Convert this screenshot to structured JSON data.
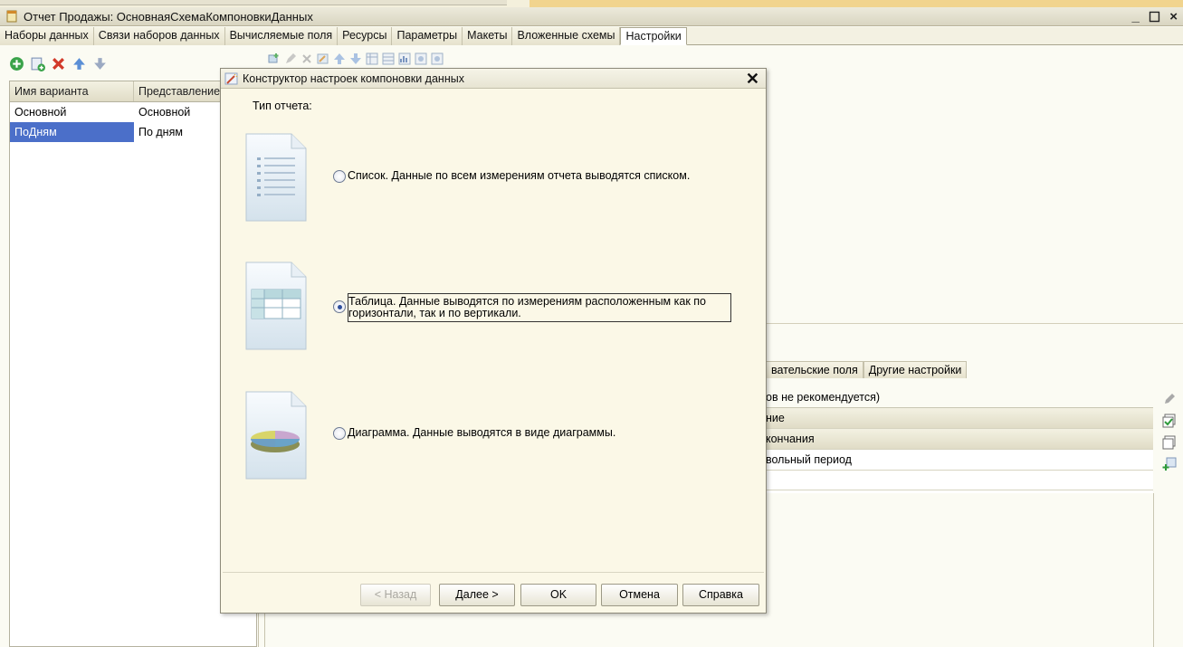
{
  "window": {
    "title": "Отчет Продажы: ОсновнаяСхемаКомпоновкиДанных",
    "controls": [
      "_",
      "☐",
      "×"
    ]
  },
  "tabs": [
    {
      "label": "Наборы данных"
    },
    {
      "label": "Связи наборов данных"
    },
    {
      "label": "Вычисляемые поля"
    },
    {
      "label": "Ресурсы"
    },
    {
      "label": "Параметры"
    },
    {
      "label": "Макеты"
    },
    {
      "label": "Вложенные схемы"
    },
    {
      "label": "Настройки",
      "active": true
    }
  ],
  "variants": {
    "headers": [
      "Имя варианта",
      "Представление"
    ],
    "rows": [
      [
        "Основной",
        "Основной"
      ],
      [
        "ПоДням",
        "По дням"
      ]
    ]
  },
  "background_panel": {
    "tabs": [
      "вательские поля",
      "Другие настройки"
    ],
    "note": "ов не рекомендуется)",
    "rows": [
      "ние",
      "кончания",
      "вольный период"
    ]
  },
  "dialog": {
    "title": "Конструктор настроек компоновки данных",
    "report_type_label": "Тип отчета:",
    "options": [
      {
        "label": "Список. Данные по всем измерениям отчета выводятся списком.",
        "selected": false
      },
      {
        "label": "Таблица. Данные выводятся по измерениям расположенным как по горизонтали, так и по вертикали.",
        "selected": true
      },
      {
        "label": "Диаграмма. Данные выводятся в виде диаграммы.",
        "selected": false
      }
    ],
    "buttons": {
      "back": "< Назад",
      "next": "Далее >",
      "ok": "OK",
      "cancel": "Отмена",
      "help": "Справка"
    }
  }
}
